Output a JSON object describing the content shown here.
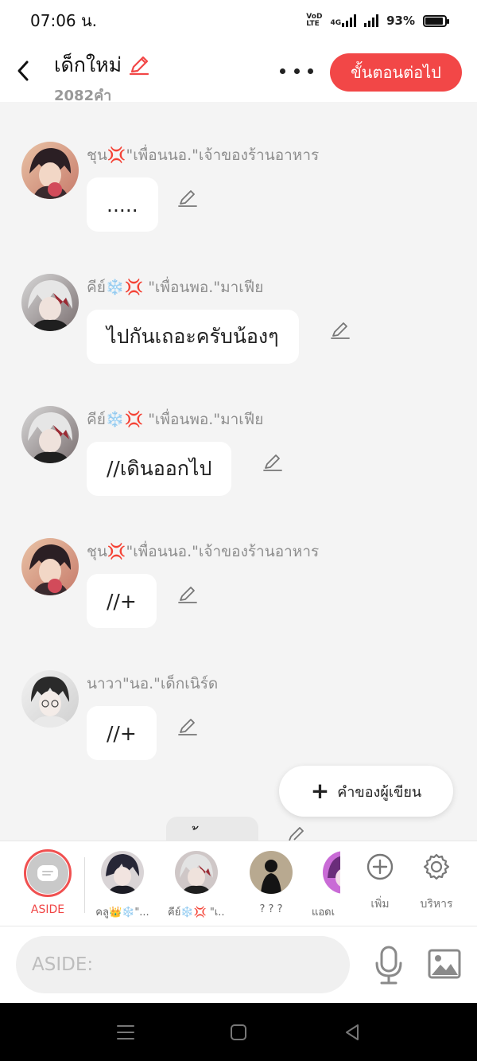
{
  "status": {
    "time": "07:06 น.",
    "net_tag_top": "VoD",
    "net_tag_bottom": "LTE",
    "net_type": "4G",
    "battery": "93%",
    "battery_level": 0.93
  },
  "header": {
    "title": "เด็กใหม่",
    "word_count": "2082คำ",
    "next_label": "ขั้นตอนต่อไป"
  },
  "messages": [
    {
      "speaker": "ชุน💢\"เพื่อนนอ.\"เจ้าของร้านอาหาร",
      "text": ".....",
      "avatar": "chun"
    },
    {
      "speaker": "คีย์❄️💢 \"เพื่อนพอ.\"มาเฟีย",
      "text": "ไปกันเถอะครับน้องๆ",
      "avatar": "key"
    },
    {
      "speaker": "คีย์❄️💢 \"เพื่อนพอ.\"มาเฟีย",
      "text": "//เดินออกไป",
      "avatar": "key"
    },
    {
      "speaker": "ชุน💢\"เพื่อนนอ.\"เจ้าของร้านอาหาร",
      "text": "//+",
      "avatar": "chun"
    },
    {
      "speaker": "นาวา\"นอ.\"เด็กเนิร์ด",
      "text": "//+",
      "avatar": "nawa"
    }
  ],
  "writer_button": "คำของผู้เขียน",
  "partial_text": "้",
  "characters": {
    "aside_label": "ASIDE",
    "items": [
      {
        "name": "คลู👑❄️\"...",
        "avatar": "klu"
      },
      {
        "name": "คีย์❄️💢 \"เ...",
        "avatar": "key"
      },
      {
        "name": "? ? ?",
        "avatar": "unknown"
      },
      {
        "name": "แอดเ",
        "avatar": "ad"
      }
    ],
    "add_label": "เพิ่ม",
    "manage_label": "บริหาร"
  },
  "input": {
    "placeholder": "ASIDE:"
  },
  "icons": {
    "back": "chevron-left-icon",
    "more": "more-dots-icon",
    "edit": "pencil-icon",
    "mic": "microphone-icon",
    "image": "image-icon",
    "add": "plus-circle-icon",
    "manage": "gear-icon"
  },
  "colors": {
    "accent": "#f24747",
    "background": "#f4f4f4"
  }
}
